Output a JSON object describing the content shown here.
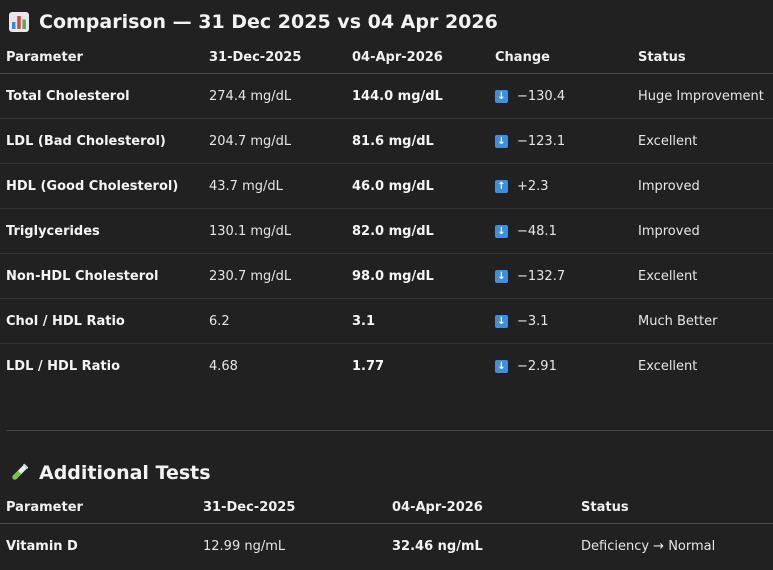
{
  "comparison": {
    "title": "Comparison — 31 Dec 2025 vs 04 Apr 2026",
    "icon": "bar-chart-icon",
    "headers": [
      "Parameter",
      "31-Dec-2025",
      "04-Apr-2026",
      "Change",
      "Status"
    ],
    "rows": [
      {
        "parameter": "Total Cholesterol",
        "before": "274.4 mg/dL",
        "after": "144.0 mg/dL",
        "direction": "down",
        "change": "−130.4",
        "status": "Huge Improvement"
      },
      {
        "parameter": "LDL (Bad Cholesterol)",
        "before": "204.7 mg/dL",
        "after": "81.6 mg/dL",
        "direction": "down",
        "change": "−123.1",
        "status": "Excellent"
      },
      {
        "parameter": "HDL (Good Cholesterol)",
        "before": "43.7 mg/dL",
        "after": "46.0 mg/dL",
        "direction": "up",
        "change": "+2.3",
        "status": "Improved"
      },
      {
        "parameter": "Triglycerides",
        "before": "130.1 mg/dL",
        "after": "82.0 mg/dL",
        "direction": "down",
        "change": "−48.1",
        "status": "Improved"
      },
      {
        "parameter": "Non-HDL Cholesterol",
        "before": "230.7 mg/dL",
        "after": "98.0 mg/dL",
        "direction": "down",
        "change": "−132.7",
        "status": "Excellent"
      },
      {
        "parameter": "Chol / HDL Ratio",
        "before": "6.2",
        "after": "3.1",
        "direction": "down",
        "change": "−3.1",
        "status": "Much Better"
      },
      {
        "parameter": "LDL / HDL Ratio",
        "before": "4.68",
        "after": "1.77",
        "direction": "down",
        "change": "−2.91",
        "status": "Excellent"
      }
    ]
  },
  "additional": {
    "title": "Additional Tests",
    "icon": "test-tube-icon",
    "headers": [
      "Parameter",
      "31-Dec-2025",
      "04-Apr-2026",
      "Status"
    ],
    "rows": [
      {
        "parameter": "Vitamin D",
        "before": "12.99 ng/mL",
        "after": "32.46 ng/mL",
        "status": "Deficiency → Normal"
      }
    ]
  },
  "colors": {
    "background": "#212121",
    "arrow_badge": "#3d8fe0",
    "divider": "#444444"
  }
}
